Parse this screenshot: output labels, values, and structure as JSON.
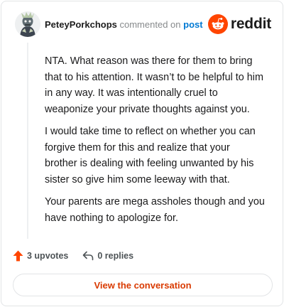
{
  "comment": {
    "author": "PeteyPorkchops",
    "action_text": "commented on",
    "target_link": "post",
    "paragraphs": [
      "NTA. What reason was there for them to bring that to his attention. It wasn’t to be helpful to him in any way. It was intentionally cruel to weaponize your private thoughts against you.",
      "I would take time to reflect on whether you can forgive them for this and realize that your brother is dealing with feeling unwanted by his sister so give him some leeway with that.",
      "Your parents are mega assholes though and you have nothing to apologize for."
    ]
  },
  "brand": {
    "wordmark": "reddit",
    "icon": "reddit-snoo-icon",
    "accent": "#ff4500"
  },
  "stats": {
    "upvotes_label": "3 upvotes",
    "upvote_icon": "upvote-arrow-icon",
    "replies_label": "0 replies",
    "reply_icon": "reply-arrow-icon"
  },
  "cta": {
    "label": "View the conversation",
    "color": "#d93a00"
  }
}
